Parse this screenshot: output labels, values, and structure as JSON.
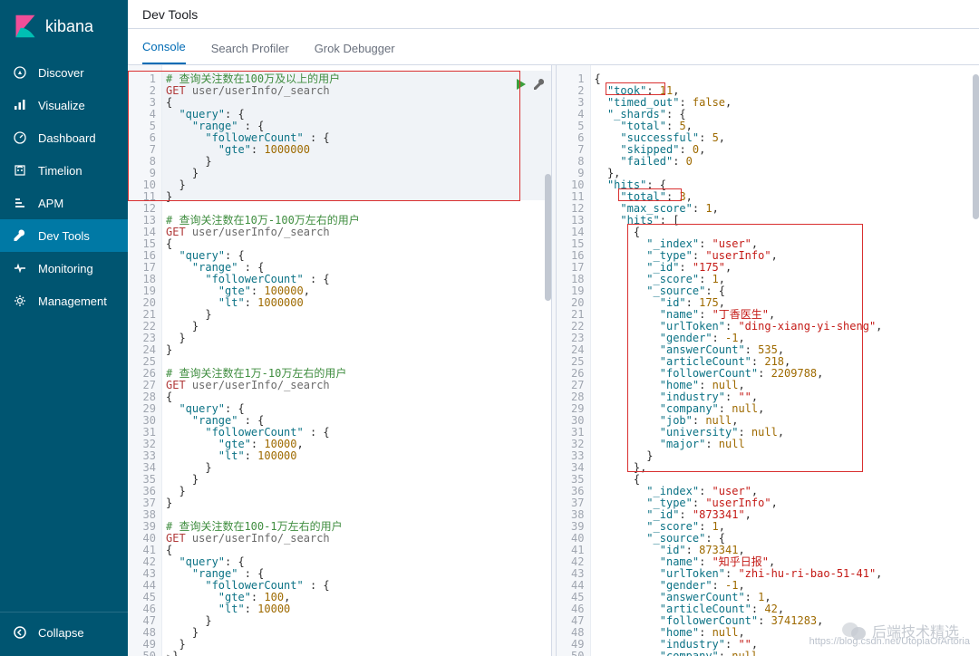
{
  "brand": {
    "name": "kibana"
  },
  "nav": {
    "items": [
      {
        "label": "Discover",
        "icon": "compass-icon"
      },
      {
        "label": "Visualize",
        "icon": "chart-icon"
      },
      {
        "label": "Dashboard",
        "icon": "dashboard-icon"
      },
      {
        "label": "Timelion",
        "icon": "timelion-icon"
      },
      {
        "label": "APM",
        "icon": "apm-icon"
      },
      {
        "label": "Dev Tools",
        "icon": "wrench-icon"
      },
      {
        "label": "Monitoring",
        "icon": "heartbeat-icon"
      },
      {
        "label": "Management",
        "icon": "gear-icon"
      }
    ],
    "active_idx": 5,
    "collapse": "Collapse"
  },
  "header": {
    "title": "Dev Tools"
  },
  "tabs": {
    "items": [
      {
        "label": "Console"
      },
      {
        "label": "Search Profiler"
      },
      {
        "label": "Grok Debugger"
      }
    ],
    "active_idx": 0
  },
  "editor_left": {
    "highlight_range": [
      1,
      11
    ],
    "line_count": 50,
    "lines": [
      {
        "t": "cmt",
        "text": "# 查询关注数在100万及以上的用户"
      },
      {
        "t": "req",
        "method": "GET",
        "path": "user/userInfo/_search"
      },
      {
        "t": "raw",
        "text": "{"
      },
      {
        "t": "kv",
        "indent": 1,
        "key": "query",
        "val": "{",
        "vt": "raw"
      },
      {
        "t": "kv",
        "indent": 2,
        "key": "range",
        "val": ": {",
        "vt": "raw2"
      },
      {
        "t": "kv",
        "indent": 3,
        "key": "followerCount",
        "val": ": {",
        "vt": "raw2"
      },
      {
        "t": "kv",
        "indent": 4,
        "key": "gte",
        "val": "1000000",
        "vt": "num"
      },
      {
        "t": "raw",
        "indent": 3,
        "text": "}"
      },
      {
        "t": "raw",
        "indent": 2,
        "text": "}"
      },
      {
        "t": "raw",
        "indent": 1,
        "text": "}"
      },
      {
        "t": "raw",
        "text": "}"
      },
      {
        "t": "blank"
      },
      {
        "t": "cmt",
        "text": "# 查询关注数在10万-100万左右的用户"
      },
      {
        "t": "req",
        "method": "GET",
        "path": "user/userInfo/_search"
      },
      {
        "t": "raw",
        "text": "{"
      },
      {
        "t": "kv",
        "indent": 1,
        "key": "query",
        "val": "{",
        "vt": "raw"
      },
      {
        "t": "kv",
        "indent": 2,
        "key": "range",
        "val": ": {",
        "vt": "raw2"
      },
      {
        "t": "kv",
        "indent": 3,
        "key": "followerCount",
        "val": ": {",
        "vt": "raw2"
      },
      {
        "t": "kv",
        "indent": 4,
        "key": "gte",
        "val": "100000",
        "vt": "num",
        "comma": true
      },
      {
        "t": "kv",
        "indent": 4,
        "key": "lt",
        "val": "1000000",
        "vt": "num"
      },
      {
        "t": "raw",
        "indent": 3,
        "text": "}"
      },
      {
        "t": "raw",
        "indent": 2,
        "text": "}"
      },
      {
        "t": "raw",
        "indent": 1,
        "text": "}"
      },
      {
        "t": "raw",
        "text": "}"
      },
      {
        "t": "blank"
      },
      {
        "t": "cmt",
        "text": "# 查询关注数在1万-10万左右的用户"
      },
      {
        "t": "req",
        "method": "GET",
        "path": "user/userInfo/_search"
      },
      {
        "t": "raw",
        "text": "{"
      },
      {
        "t": "kv",
        "indent": 1,
        "key": "query",
        "val": "{",
        "vt": "raw"
      },
      {
        "t": "kv",
        "indent": 2,
        "key": "range",
        "val": ": {",
        "vt": "raw2"
      },
      {
        "t": "kv",
        "indent": 3,
        "key": "followerCount",
        "val": ": {",
        "vt": "raw2"
      },
      {
        "t": "kv",
        "indent": 4,
        "key": "gte",
        "val": "10000",
        "vt": "num",
        "comma": true
      },
      {
        "t": "kv",
        "indent": 4,
        "key": "lt",
        "val": "100000",
        "vt": "num"
      },
      {
        "t": "raw",
        "indent": 3,
        "text": "}"
      },
      {
        "t": "raw",
        "indent": 2,
        "text": "}"
      },
      {
        "t": "raw",
        "indent": 1,
        "text": "}"
      },
      {
        "t": "raw",
        "text": "}"
      },
      {
        "t": "blank"
      },
      {
        "t": "cmt",
        "text": "# 查询关注数在100-1万左右的用户"
      },
      {
        "t": "req",
        "method": "GET",
        "path": "user/userInfo/_search"
      },
      {
        "t": "raw",
        "text": "{"
      },
      {
        "t": "kv",
        "indent": 1,
        "key": "query",
        "val": "{",
        "vt": "raw"
      },
      {
        "t": "kv",
        "indent": 2,
        "key": "range",
        "val": ": {",
        "vt": "raw2"
      },
      {
        "t": "kv",
        "indent": 3,
        "key": "followerCount",
        "val": ": {",
        "vt": "raw2"
      },
      {
        "t": "kv",
        "indent": 4,
        "key": "gte",
        "val": "100",
        "vt": "num",
        "comma": true
      },
      {
        "t": "kv",
        "indent": 4,
        "key": "lt",
        "val": "10000",
        "vt": "num"
      },
      {
        "t": "raw",
        "indent": 3,
        "text": "}"
      },
      {
        "t": "raw",
        "indent": 2,
        "text": "}"
      },
      {
        "t": "raw",
        "indent": 1,
        "text": "}"
      },
      {
        "t": "collapse",
        "text": "}"
      }
    ]
  },
  "editor_right": {
    "line_count": 50,
    "lines": [
      {
        "t": "raw",
        "text": "{"
      },
      {
        "t": "kv",
        "indent": 1,
        "key": "took",
        "val": "11",
        "vt": "num",
        "comma": true
      },
      {
        "t": "kv",
        "indent": 1,
        "key": "timed_out",
        "val": "false",
        "vt": "bool",
        "comma": true
      },
      {
        "t": "kv",
        "indent": 1,
        "key": "_shards",
        "val": "{",
        "vt": "raw"
      },
      {
        "t": "kv",
        "indent": 2,
        "key": "total",
        "val": "5",
        "vt": "num",
        "comma": true
      },
      {
        "t": "kv",
        "indent": 2,
        "key": "successful",
        "val": "5",
        "vt": "num",
        "comma": true
      },
      {
        "t": "kv",
        "indent": 2,
        "key": "skipped",
        "val": "0",
        "vt": "num",
        "comma": true
      },
      {
        "t": "kv",
        "indent": 2,
        "key": "failed",
        "val": "0",
        "vt": "num"
      },
      {
        "t": "raw",
        "indent": 1,
        "text": "},"
      },
      {
        "t": "kv",
        "indent": 1,
        "key": "hits",
        "val": "{",
        "vt": "raw"
      },
      {
        "t": "kv",
        "indent": 2,
        "key": "total",
        "val": "3",
        "vt": "num",
        "comma": true
      },
      {
        "t": "kv",
        "indent": 2,
        "key": "max_score",
        "val": "1",
        "vt": "num",
        "comma": true
      },
      {
        "t": "kv",
        "indent": 2,
        "key": "hits",
        "val": "[",
        "vt": "raw"
      },
      {
        "t": "raw",
        "indent": 3,
        "text": "{"
      },
      {
        "t": "kv",
        "indent": 4,
        "key": "_index",
        "val": "user",
        "vt": "str",
        "comma": true
      },
      {
        "t": "kv",
        "indent": 4,
        "key": "_type",
        "val": "userInfo",
        "vt": "str",
        "comma": true
      },
      {
        "t": "kv",
        "indent": 4,
        "key": "_id",
        "val": "175",
        "vt": "str",
        "comma": true
      },
      {
        "t": "kv",
        "indent": 4,
        "key": "_score",
        "val": "1",
        "vt": "num",
        "comma": true
      },
      {
        "t": "kv",
        "indent": 4,
        "key": "_source",
        "val": "{",
        "vt": "raw"
      },
      {
        "t": "kv",
        "indent": 5,
        "key": "id",
        "val": "175",
        "vt": "num",
        "comma": true
      },
      {
        "t": "kv",
        "indent": 5,
        "key": "name",
        "val": "丁香医生",
        "vt": "str",
        "comma": true
      },
      {
        "t": "kv",
        "indent": 5,
        "key": "urlToken",
        "val": "ding-xiang-yi-sheng",
        "vt": "str",
        "comma": true
      },
      {
        "t": "kv",
        "indent": 5,
        "key": "gender",
        "val": "-1",
        "vt": "num",
        "comma": true
      },
      {
        "t": "kv",
        "indent": 5,
        "key": "answerCount",
        "val": "535",
        "vt": "num",
        "comma": true
      },
      {
        "t": "kv",
        "indent": 5,
        "key": "articleCount",
        "val": "218",
        "vt": "num",
        "comma": true
      },
      {
        "t": "kv",
        "indent": 5,
        "key": "followerCount",
        "val": "2209788",
        "vt": "num",
        "comma": true
      },
      {
        "t": "kv",
        "indent": 5,
        "key": "home",
        "val": "null",
        "vt": "null",
        "comma": true
      },
      {
        "t": "kv",
        "indent": 5,
        "key": "industry",
        "val": "",
        "vt": "str",
        "comma": true
      },
      {
        "t": "kv",
        "indent": 5,
        "key": "company",
        "val": "null",
        "vt": "null",
        "comma": true
      },
      {
        "t": "kv",
        "indent": 5,
        "key": "job",
        "val": "null",
        "vt": "null",
        "comma": true
      },
      {
        "t": "kv",
        "indent": 5,
        "key": "university",
        "val": "null",
        "vt": "null",
        "comma": true
      },
      {
        "t": "kv",
        "indent": 5,
        "key": "major",
        "val": "null",
        "vt": "null"
      },
      {
        "t": "raw",
        "indent": 4,
        "text": "}"
      },
      {
        "t": "raw",
        "indent": 3,
        "text": "},"
      },
      {
        "t": "raw",
        "indent": 3,
        "text": "{"
      },
      {
        "t": "kv",
        "indent": 4,
        "key": "_index",
        "val": "user",
        "vt": "str",
        "comma": true
      },
      {
        "t": "kv",
        "indent": 4,
        "key": "_type",
        "val": "userInfo",
        "vt": "str",
        "comma": true
      },
      {
        "t": "kv",
        "indent": 4,
        "key": "_id",
        "val": "873341",
        "vt": "str",
        "comma": true
      },
      {
        "t": "kv",
        "indent": 4,
        "key": "_score",
        "val": "1",
        "vt": "num",
        "comma": true
      },
      {
        "t": "kv",
        "indent": 4,
        "key": "_source",
        "val": "{",
        "vt": "raw"
      },
      {
        "t": "kv",
        "indent": 5,
        "key": "id",
        "val": "873341",
        "vt": "num",
        "comma": true
      },
      {
        "t": "kv",
        "indent": 5,
        "key": "name",
        "val": "知乎日报",
        "vt": "str",
        "comma": true
      },
      {
        "t": "kv",
        "indent": 5,
        "key": "urlToken",
        "val": "zhi-hu-ri-bao-51-41",
        "vt": "str",
        "comma": true
      },
      {
        "t": "kv",
        "indent": 5,
        "key": "gender",
        "val": "-1",
        "vt": "num",
        "comma": true
      },
      {
        "t": "kv",
        "indent": 5,
        "key": "answerCount",
        "val": "1",
        "vt": "num",
        "comma": true
      },
      {
        "t": "kv",
        "indent": 5,
        "key": "articleCount",
        "val": "42",
        "vt": "num",
        "comma": true
      },
      {
        "t": "kv",
        "indent": 5,
        "key": "followerCount",
        "val": "3741283",
        "vt": "num",
        "comma": true
      },
      {
        "t": "kv",
        "indent": 5,
        "key": "home",
        "val": "null",
        "vt": "null",
        "comma": true
      },
      {
        "t": "kv",
        "indent": 5,
        "key": "industry",
        "val": "",
        "vt": "str",
        "comma": true
      },
      {
        "t": "kv",
        "indent": 5,
        "key": "company",
        "val": "null",
        "vt": "null",
        "comma": true
      }
    ]
  },
  "overlay": {
    "wechat_text": "后端技术精选",
    "csdn_text": "https://blog.csdn.net/UtopiaOfArtoria"
  }
}
